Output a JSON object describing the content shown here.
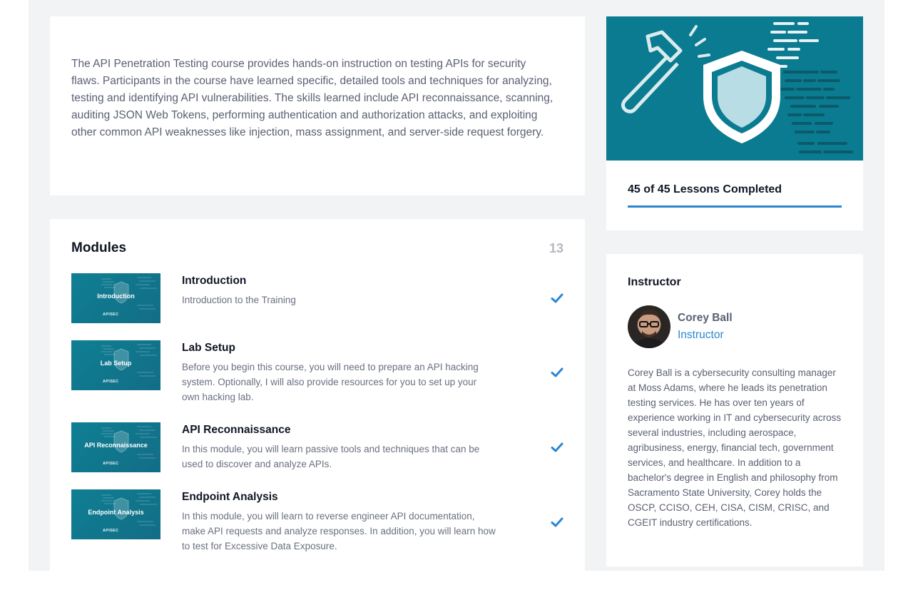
{
  "course": {
    "description": "The API Penetration Testing course provides hands-on instruction on testing APIs for security flaws. Participants in the course have learned specific, detailed tools and techniques for analyzing, testing and identifying API vulnerabilities. The skills learned include API reconnaissance, scanning, auditing JSON Web Tokens, performing authentication and authorization attacks, and exploiting other common API weaknesses like injection, mass assignment, and server-side request forgery.",
    "progress_label": "45 of 45 Lessons Completed",
    "progress_fraction": 1.0
  },
  "modules": {
    "title": "Modules",
    "count": "13",
    "items": [
      {
        "thumb_label": "Introduction",
        "thumb_brand": "APISEC",
        "title": "Introduction",
        "desc": "Introduction to the Training",
        "completed": true
      },
      {
        "thumb_label": "Lab Setup",
        "thumb_brand": "APISEC",
        "title": "Lab Setup",
        "desc": "Before you begin this course, you will need to prepare an API hacking system. Optionally, I will also provide resources for you to set up your own hacking lab.",
        "completed": true
      },
      {
        "thumb_label": "API Reconnaissance",
        "thumb_brand": "APISEC",
        "title": "API Reconnaissance",
        "desc": "In this module, you will learn passive tools and techniques that can be used to discover and analyze APIs.",
        "completed": true
      },
      {
        "thumb_label": "Endpoint Analysis",
        "thumb_brand": "APISEC",
        "title": "Endpoint Analysis",
        "desc": "In this module, you will learn to reverse engineer API documentation, make API requests and analyze responses. In addition, you will learn how to test for Excessive Data Exposure.",
        "completed": true
      }
    ]
  },
  "instructor": {
    "heading": "Instructor",
    "name": "Corey Ball",
    "role": "Instructor",
    "bio": "Corey Ball is a cybersecurity consulting manager at Moss Adams, where he leads its penetration testing services. He has over ten years of experience working in IT and cybersecurity across several industries, including aerospace, agribusiness, energy, financial tech, government services, and healthcare. In addition to a bachelor's degree in English and philosophy from Sacramento State University, Corey holds the OSCP, CCISO, CEH, CISA, CISM, CRISC, and CGEIT industry certifications."
  },
  "icons": {
    "check": "check-icon",
    "hammer": "hammer-icon",
    "shield": "shield-icon"
  },
  "colors": {
    "accent": "#2b86d2",
    "banner": "#0a7b90",
    "thumb": "#0f7f93"
  }
}
